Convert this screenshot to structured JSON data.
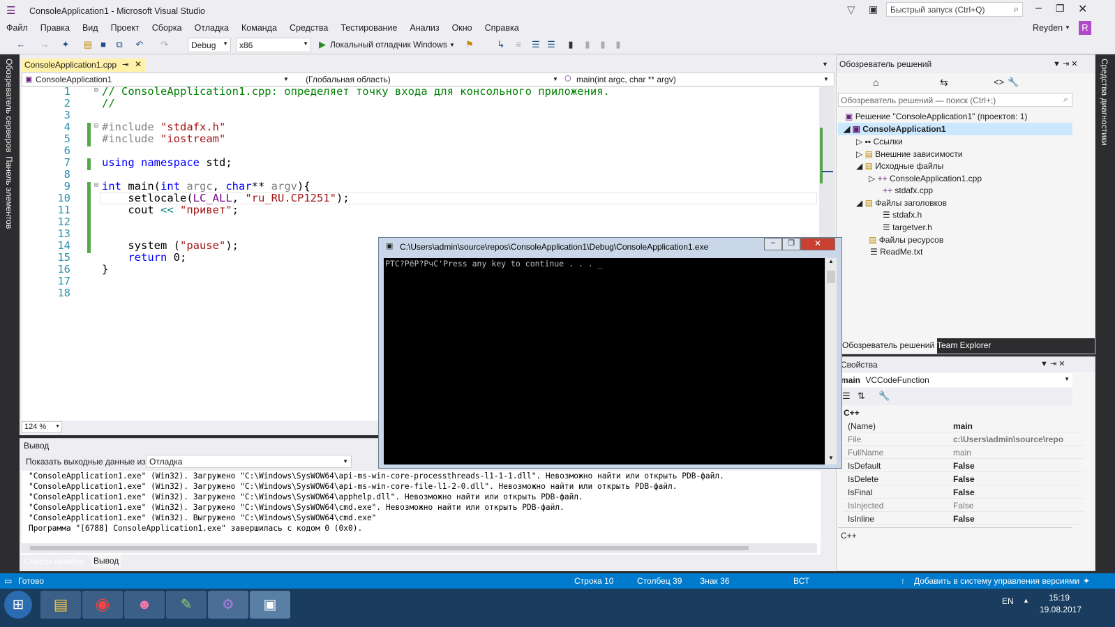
{
  "window": {
    "title": "ConsoleApplication1 - Microsoft Visual Studio",
    "quick_launch": "Быстрый запуск (Ctrl+Q)",
    "user": "Reyden",
    "avatar_letter": "R"
  },
  "menu": [
    "Файл",
    "Правка",
    "Вид",
    "Проект",
    "Сборка",
    "Отладка",
    "Команда",
    "Средства",
    "Тестирование",
    "Анализ",
    "Окно",
    "Справка"
  ],
  "toolbar": {
    "config": "Debug",
    "platform": "x86",
    "run_label": "Локальный отладчик Windows"
  },
  "left_strip": {
    "server_explorer": "Обозреватель серверов",
    "toolbox": "Панель элементов"
  },
  "right_strip": {
    "diagnostics": "Средства диагностики"
  },
  "editor": {
    "tab": "ConsoleApplication1.cpp",
    "nav_project": "ConsoleApplication1",
    "nav_scope": "(Глобальная область)",
    "nav_member": "main(int argc, char ** argv)",
    "zoom": "124 %",
    "lines": [
      "1",
      "2",
      "3",
      "4",
      "5",
      "6",
      "7",
      "8",
      "9",
      "10",
      "11",
      "12",
      "13",
      "14",
      "15",
      "16",
      "17",
      "18"
    ]
  },
  "code": {
    "l1": "// ConsoleApplication1.cpp: определяет точку входа для консольного приложения.",
    "l2": "//",
    "l4_kw": "#include",
    "l4_str": "\"stdafx.h\"",
    "l5_kw": "#include",
    "l5_str": "\"iostream\"",
    "l7_a": "using",
    "l7_b": "namespace",
    "l7_c": " std;",
    "l9_a": "int",
    "l9_b": " main(",
    "l9_c": "int",
    "l9_d": " argc",
    "l9_e": ", ",
    "l9_f": "char",
    "l9_g": "** ",
    "l9_h": "argv",
    "l9_i": "){",
    "l10_a": "    setlocale(",
    "l10_b": "LC_ALL",
    "l10_c": ", ",
    "l10_d": "\"ru_RU.CP1251\"",
    "l10_e": ");",
    "l11_a": "    cout ",
    "l11_b": "<<",
    "l11_c": " ",
    "l11_d": "\"привет\"",
    "l11_e": ";",
    "l14_a": "    system (",
    "l14_b": "\"pause\"",
    "l14_c": ");",
    "l15_a": "    ",
    "l15_b": "return",
    "l15_c": " 0;",
    "l16": "}"
  },
  "output": {
    "title": "Вывод",
    "show_label": "Показать выходные данные из:",
    "source": "Отладка",
    "lines": [
      "\"ConsoleApplication1.exe\" (Win32). Загружено \"C:\\Windows\\SysWOW64\\api-ms-win-core-processthreads-l1-1-1.dll\". Невозможно найти или открыть PDB-файл.",
      "\"ConsoleApplication1.exe\" (Win32). Загружено \"C:\\Windows\\SysWOW64\\api-ms-win-core-file-l1-2-0.dll\". Невозможно найти или открыть PDB-файл.",
      "\"ConsoleApplication1.exe\" (Win32). Загружено \"C:\\Windows\\SysWOW64\\apphelp.dll\". Невозможно найти или открыть PDB-файл.",
      "\"ConsoleApplication1.exe\" (Win32). Загружено \"C:\\Windows\\SysWOW64\\cmd.exe\". Невозможно найти или открыть PDB-файл.",
      "\"ConsoleApplication1.exe\" (Win32). Выгружено \"C:\\Windows\\SysWOW64\\cmd.exe\"",
      "Программа \"[6788] ConsoleApplication1.exe\" завершилась с кодом 0 (0x0)."
    ],
    "tab_errors": "Список ошибок",
    "tab_output": "Вывод"
  },
  "solution_explorer": {
    "title": "Обозреватель решений",
    "search": "Обозреватель решений — поиск (Ctrl+;)",
    "solution": "Решение \"ConsoleApplication1\" (проектов: 1)",
    "project": "ConsoleApplication1",
    "refs": "Ссылки",
    "ext_deps": "Внешние зависимости",
    "source_files": "Исходные файлы",
    "src1": "ConsoleApplication1.cpp",
    "src2": "stdafx.cpp",
    "header_files": "Файлы заголовков",
    "h1": "stdafx.h",
    "h2": "targetver.h",
    "resource_files": "Файлы ресурсов",
    "readme": "ReadMe.txt",
    "tab_se": "Обозреватель решений",
    "tab_te": "Team Explorer"
  },
  "properties": {
    "title": "Свойства",
    "object_name": "main",
    "object_type": "VCCodeFunction",
    "category": "C++",
    "rows": [
      {
        "name": "(Name)",
        "value": "main"
      },
      {
        "name": "File",
        "value": "c:\\Users\\admin\\source\\repo"
      },
      {
        "name": "FullName",
        "value": "main"
      },
      {
        "name": "IsDefault",
        "value": "False"
      },
      {
        "name": "IsDelete",
        "value": "False"
      },
      {
        "name": "IsFinal",
        "value": "False"
      },
      {
        "name": "IsInjected",
        "value": "False"
      },
      {
        "name": "IsInline",
        "value": "False"
      }
    ],
    "description": "C++"
  },
  "console": {
    "title": "C:\\Users\\admin\\source\\repos\\ConsoleApplication1\\Debug\\ConsoleApplication1.exe",
    "output": "PТС?РёР?РчС'Press any key to continue . . . _"
  },
  "status": {
    "ready": "Готово",
    "line": "Строка 10",
    "col": "Столбец 39",
    "ch": "Знак 36",
    "ins": "ВСТ",
    "scm": "Добавить в систему управления версиями"
  },
  "taskbar": {
    "lang": "EN",
    "time": "15:19",
    "date": "19.08.2017"
  }
}
